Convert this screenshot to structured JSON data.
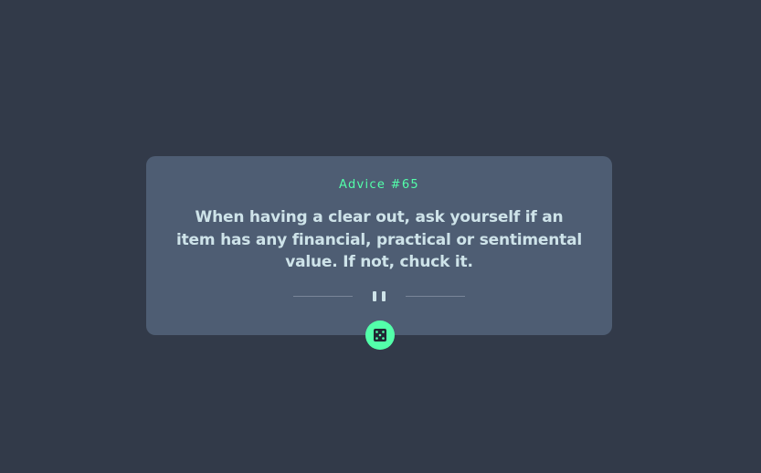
{
  "advice": {
    "label": "Advice #65",
    "text": "When having a clear out, ask yourself if an item has any financial, practical or sentimental value. If not, chuck it."
  },
  "icons": {
    "divider": "pause-icon",
    "button": "dice-icon"
  },
  "colors": {
    "background": "#323a49",
    "card": "#4e5d73",
    "accent": "#53ffaa",
    "text": "#cee3e9"
  }
}
